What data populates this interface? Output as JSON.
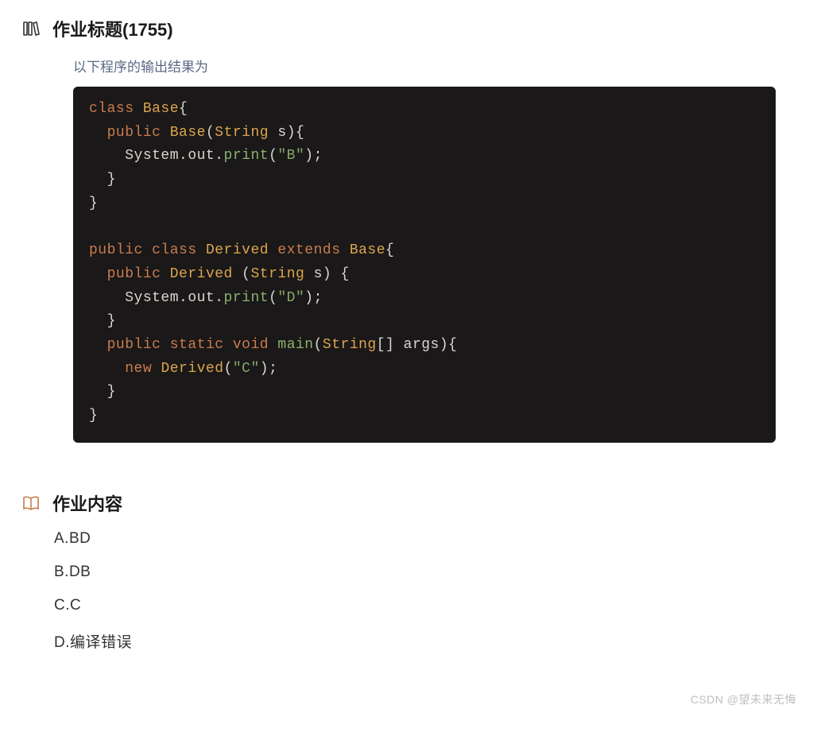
{
  "header1": {
    "title": "作业标题(1755)",
    "question": "以下程序的输出结果为"
  },
  "code": {
    "l1": {
      "kw1": "class",
      "cls1": "Base",
      "p1": "{"
    },
    "l2": {
      "kw1": "public",
      "cls1": "Base",
      "p1": "(",
      "cls2": "String",
      "arg": " s",
      "p2": "){"
    },
    "l3": {
      "t1": "System.out.",
      "m1": "print",
      "p1": "(",
      "s1": "\"B\"",
      "p2": ");"
    },
    "l4": {
      "p1": "}"
    },
    "l5": {
      "p1": "}"
    },
    "l7": {
      "kw1": "public",
      "kw2": "class",
      "cls1": "Derived",
      "kw3": "extends",
      "cls2": "Base",
      "p1": "{"
    },
    "l8": {
      "kw1": "public",
      "cls1": "Derived",
      "sp": " ",
      "p1": "(",
      "cls2": "String",
      "arg": " s",
      "p2": ") {"
    },
    "l9": {
      "t1": "System.out.",
      "m1": "print",
      "p1": "(",
      "s1": "\"D\"",
      "p2": ");"
    },
    "l10": {
      "p1": "}"
    },
    "l11": {
      "kw1": "public",
      "kw2": "static",
      "kw3": "void",
      "m1": "main",
      "p1": "(",
      "cls1": "String",
      "p2": "[] args){"
    },
    "l12": {
      "kw1": "new",
      "cls1": "Derived",
      "p1": "(",
      "s1": "\"C\"",
      "p2": ");"
    },
    "l13": {
      "p1": "}"
    },
    "l14": {
      "p1": "}"
    }
  },
  "header2": {
    "title": "作业内容"
  },
  "options": [
    "A.BD",
    "B.DB",
    "C.C",
    "D.编译错误"
  ],
  "watermark": "CSDN @望未来无悔"
}
